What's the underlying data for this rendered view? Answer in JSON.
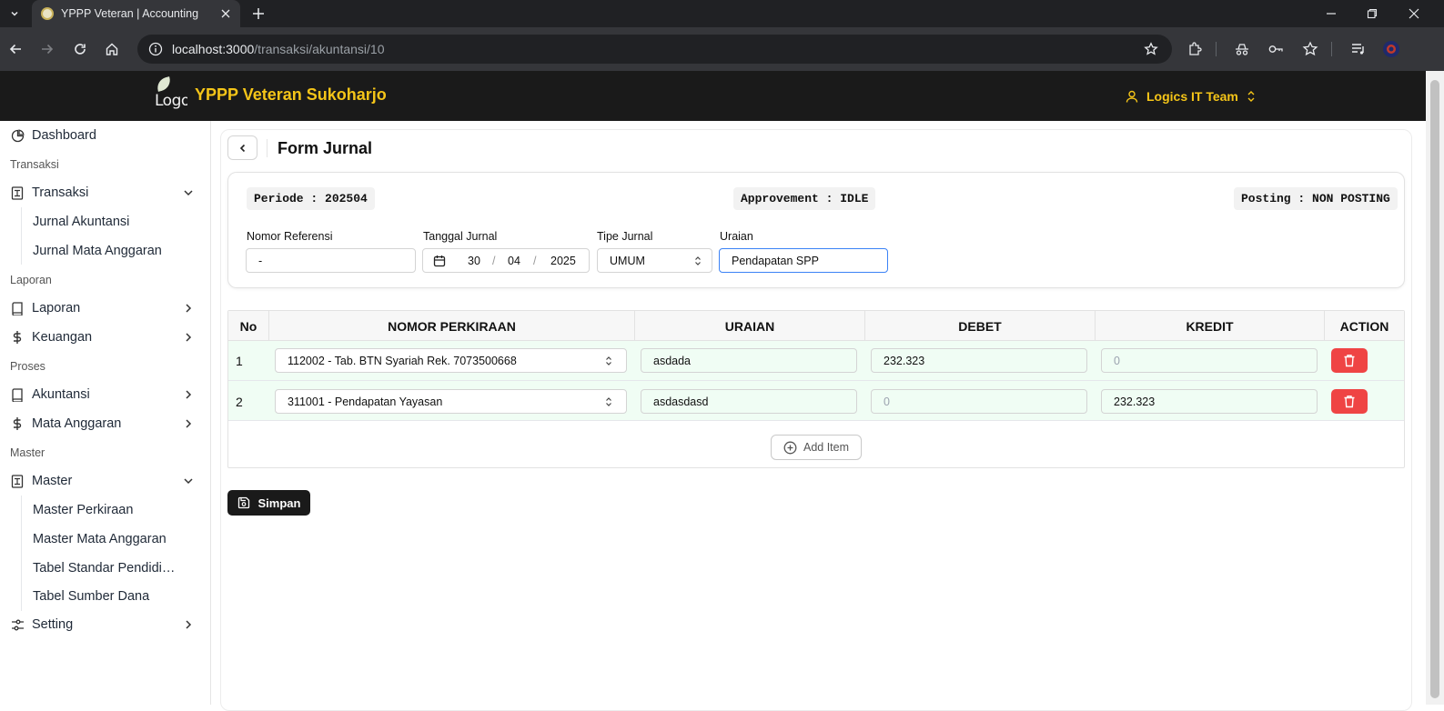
{
  "browser": {
    "tab_title": "YPPP Veteran | Accounting",
    "url_host": "localhost:3000",
    "url_path": "/transaksi/akuntansi/10"
  },
  "header": {
    "logo_text": "Logo",
    "brand": "YPPP Veteran Sukoharjo",
    "user": "Logics IT Team"
  },
  "sidebar": {
    "dashboard": "Dashboard",
    "section_transaksi": "Transaksi",
    "transaksi": "Transaksi",
    "jurnal_akuntansi": "Jurnal Akuntansi",
    "jurnal_mata_anggaran": "Jurnal Mata Anggaran",
    "section_laporan": "Laporan",
    "laporan": "Laporan",
    "keuangan": "Keuangan",
    "section_proses": "Proses",
    "akuntansi": "Akuntansi",
    "mata_anggaran": "Mata Anggaran",
    "section_master": "Master",
    "master": "Master",
    "master_perkiraan": "Master Perkiraan",
    "master_mata_anggaran": "Master Mata Anggaran",
    "tabel_standar": "Tabel Standar Pendidikan",
    "tabel_sumber_dana": "Tabel Sumber Dana",
    "setting": "Setting"
  },
  "form": {
    "title": "Form Jurnal",
    "periode": "Periode : 202504",
    "approvement": "Approvement : IDLE",
    "posting": "Posting : NON POSTING",
    "label_nomor_referensi": "Nomor Referensi",
    "nomor_referensi": "-",
    "label_tanggal": "Tanggal Jurnal",
    "tanggal_day": "30",
    "tanggal_month": "04",
    "tanggal_year": "2025",
    "label_tipe": "Tipe Jurnal",
    "tipe": "UMUM",
    "label_uraian": "Uraian",
    "uraian": "Pendapatan SPP"
  },
  "table": {
    "headers": {
      "no": "No",
      "nomor_perkiraan": "NOMOR PERKIRAAN",
      "uraian": "URAIAN",
      "debet": "DEBET",
      "kredit": "KREDIT",
      "action": "ACTION"
    },
    "rows": [
      {
        "no": "1",
        "perkiraan": "112002 - Tab. BTN Syariah Rek. 7073500668",
        "uraian": "asdada",
        "debet": "232.323",
        "kredit": "0"
      },
      {
        "no": "2",
        "perkiraan": "311001 - Pendapatan Yayasan",
        "uraian": "asdasdasd",
        "debet": "0",
        "kredit": "232.323"
      }
    ],
    "add_item": "Add Item"
  },
  "actions": {
    "save": "Simpan"
  },
  "colors": {
    "brand_yellow": "#f5c518",
    "header_bg": "#1a1a1a",
    "row_bg": "#f0fdf4",
    "delete_red": "#ef4444",
    "focus_blue": "#3b82f6"
  }
}
